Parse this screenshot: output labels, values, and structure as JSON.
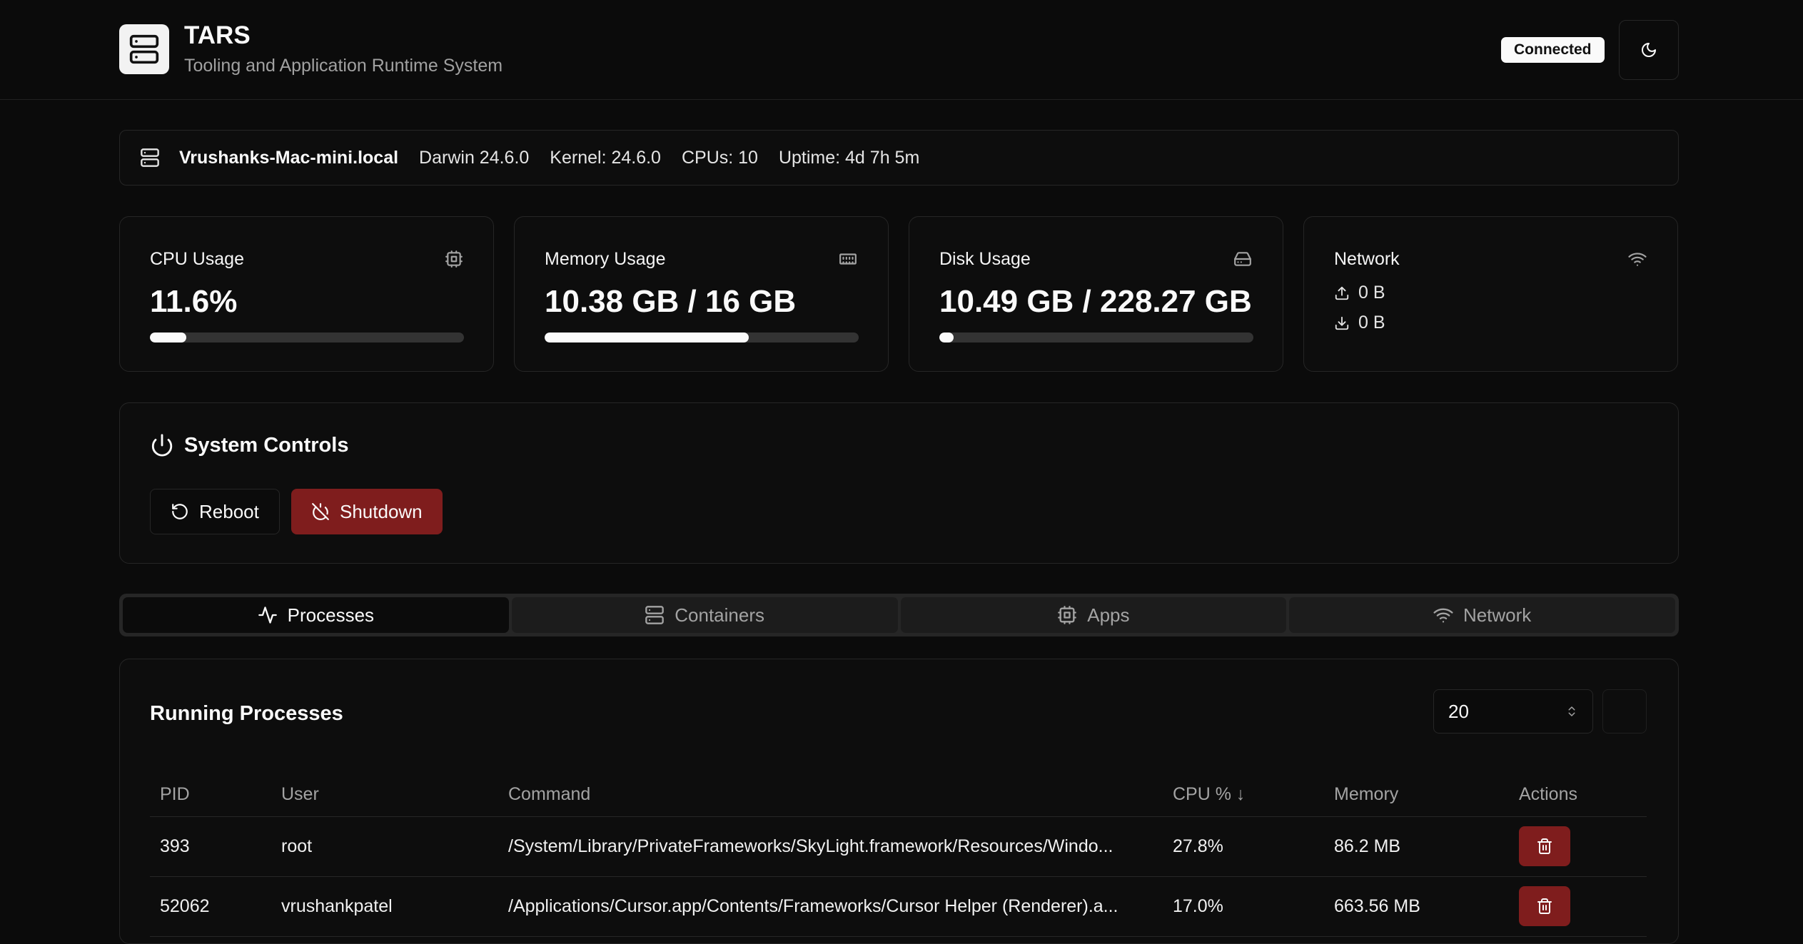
{
  "app": {
    "title": "TARS",
    "subtitle": "Tooling and Application Runtime System",
    "status": "Connected"
  },
  "system": {
    "hostname": "Vrushanks-Mac-mini.local",
    "os": "Darwin 24.6.0",
    "kernel": "Kernel: 24.6.0",
    "cpus": "CPUs: 10",
    "uptime": "Uptime: 4d 7h 5m"
  },
  "stats": {
    "cpu": {
      "title": "CPU Usage",
      "value": "11.6%",
      "percent": 11.6
    },
    "memory": {
      "title": "Memory Usage",
      "value": "10.38 GB / 16 GB",
      "percent": 64.9
    },
    "disk": {
      "title": "Disk Usage",
      "value": "10.49 GB / 228.27 GB",
      "percent": 4.6
    },
    "network": {
      "title": "Network",
      "upload": "0 B",
      "download": "0 B"
    }
  },
  "controls": {
    "title": "System Controls",
    "reboot_label": "Reboot",
    "shutdown_label": "Shutdown"
  },
  "tabs": [
    {
      "label": "Processes",
      "active": true
    },
    {
      "label": "Containers",
      "active": false
    },
    {
      "label": "Apps",
      "active": false
    },
    {
      "label": "Network",
      "active": false
    }
  ],
  "processes": {
    "title": "Running Processes",
    "limit": "20",
    "columns": [
      "PID",
      "User",
      "Command",
      "CPU % ↓",
      "Memory",
      "Actions"
    ],
    "rows": [
      {
        "pid": "393",
        "user": "root",
        "command": "/System/Library/PrivateFrameworks/SkyLight.framework/Resources/Windo...",
        "cpu": "27.8%",
        "memory": "86.2 MB"
      },
      {
        "pid": "52062",
        "user": "vrushankpatel",
        "command": "/Applications/Cursor.app/Contents/Frameworks/Cursor Helper (Renderer).a...",
        "cpu": "17.0%",
        "memory": "663.56 MB"
      }
    ]
  },
  "colors": {
    "background": "#0b0b0b",
    "card": "#0d0d0d",
    "border": "#262626",
    "danger": "#7f1d1d",
    "text": "#fafafa",
    "muted": "#a3a3a3"
  }
}
